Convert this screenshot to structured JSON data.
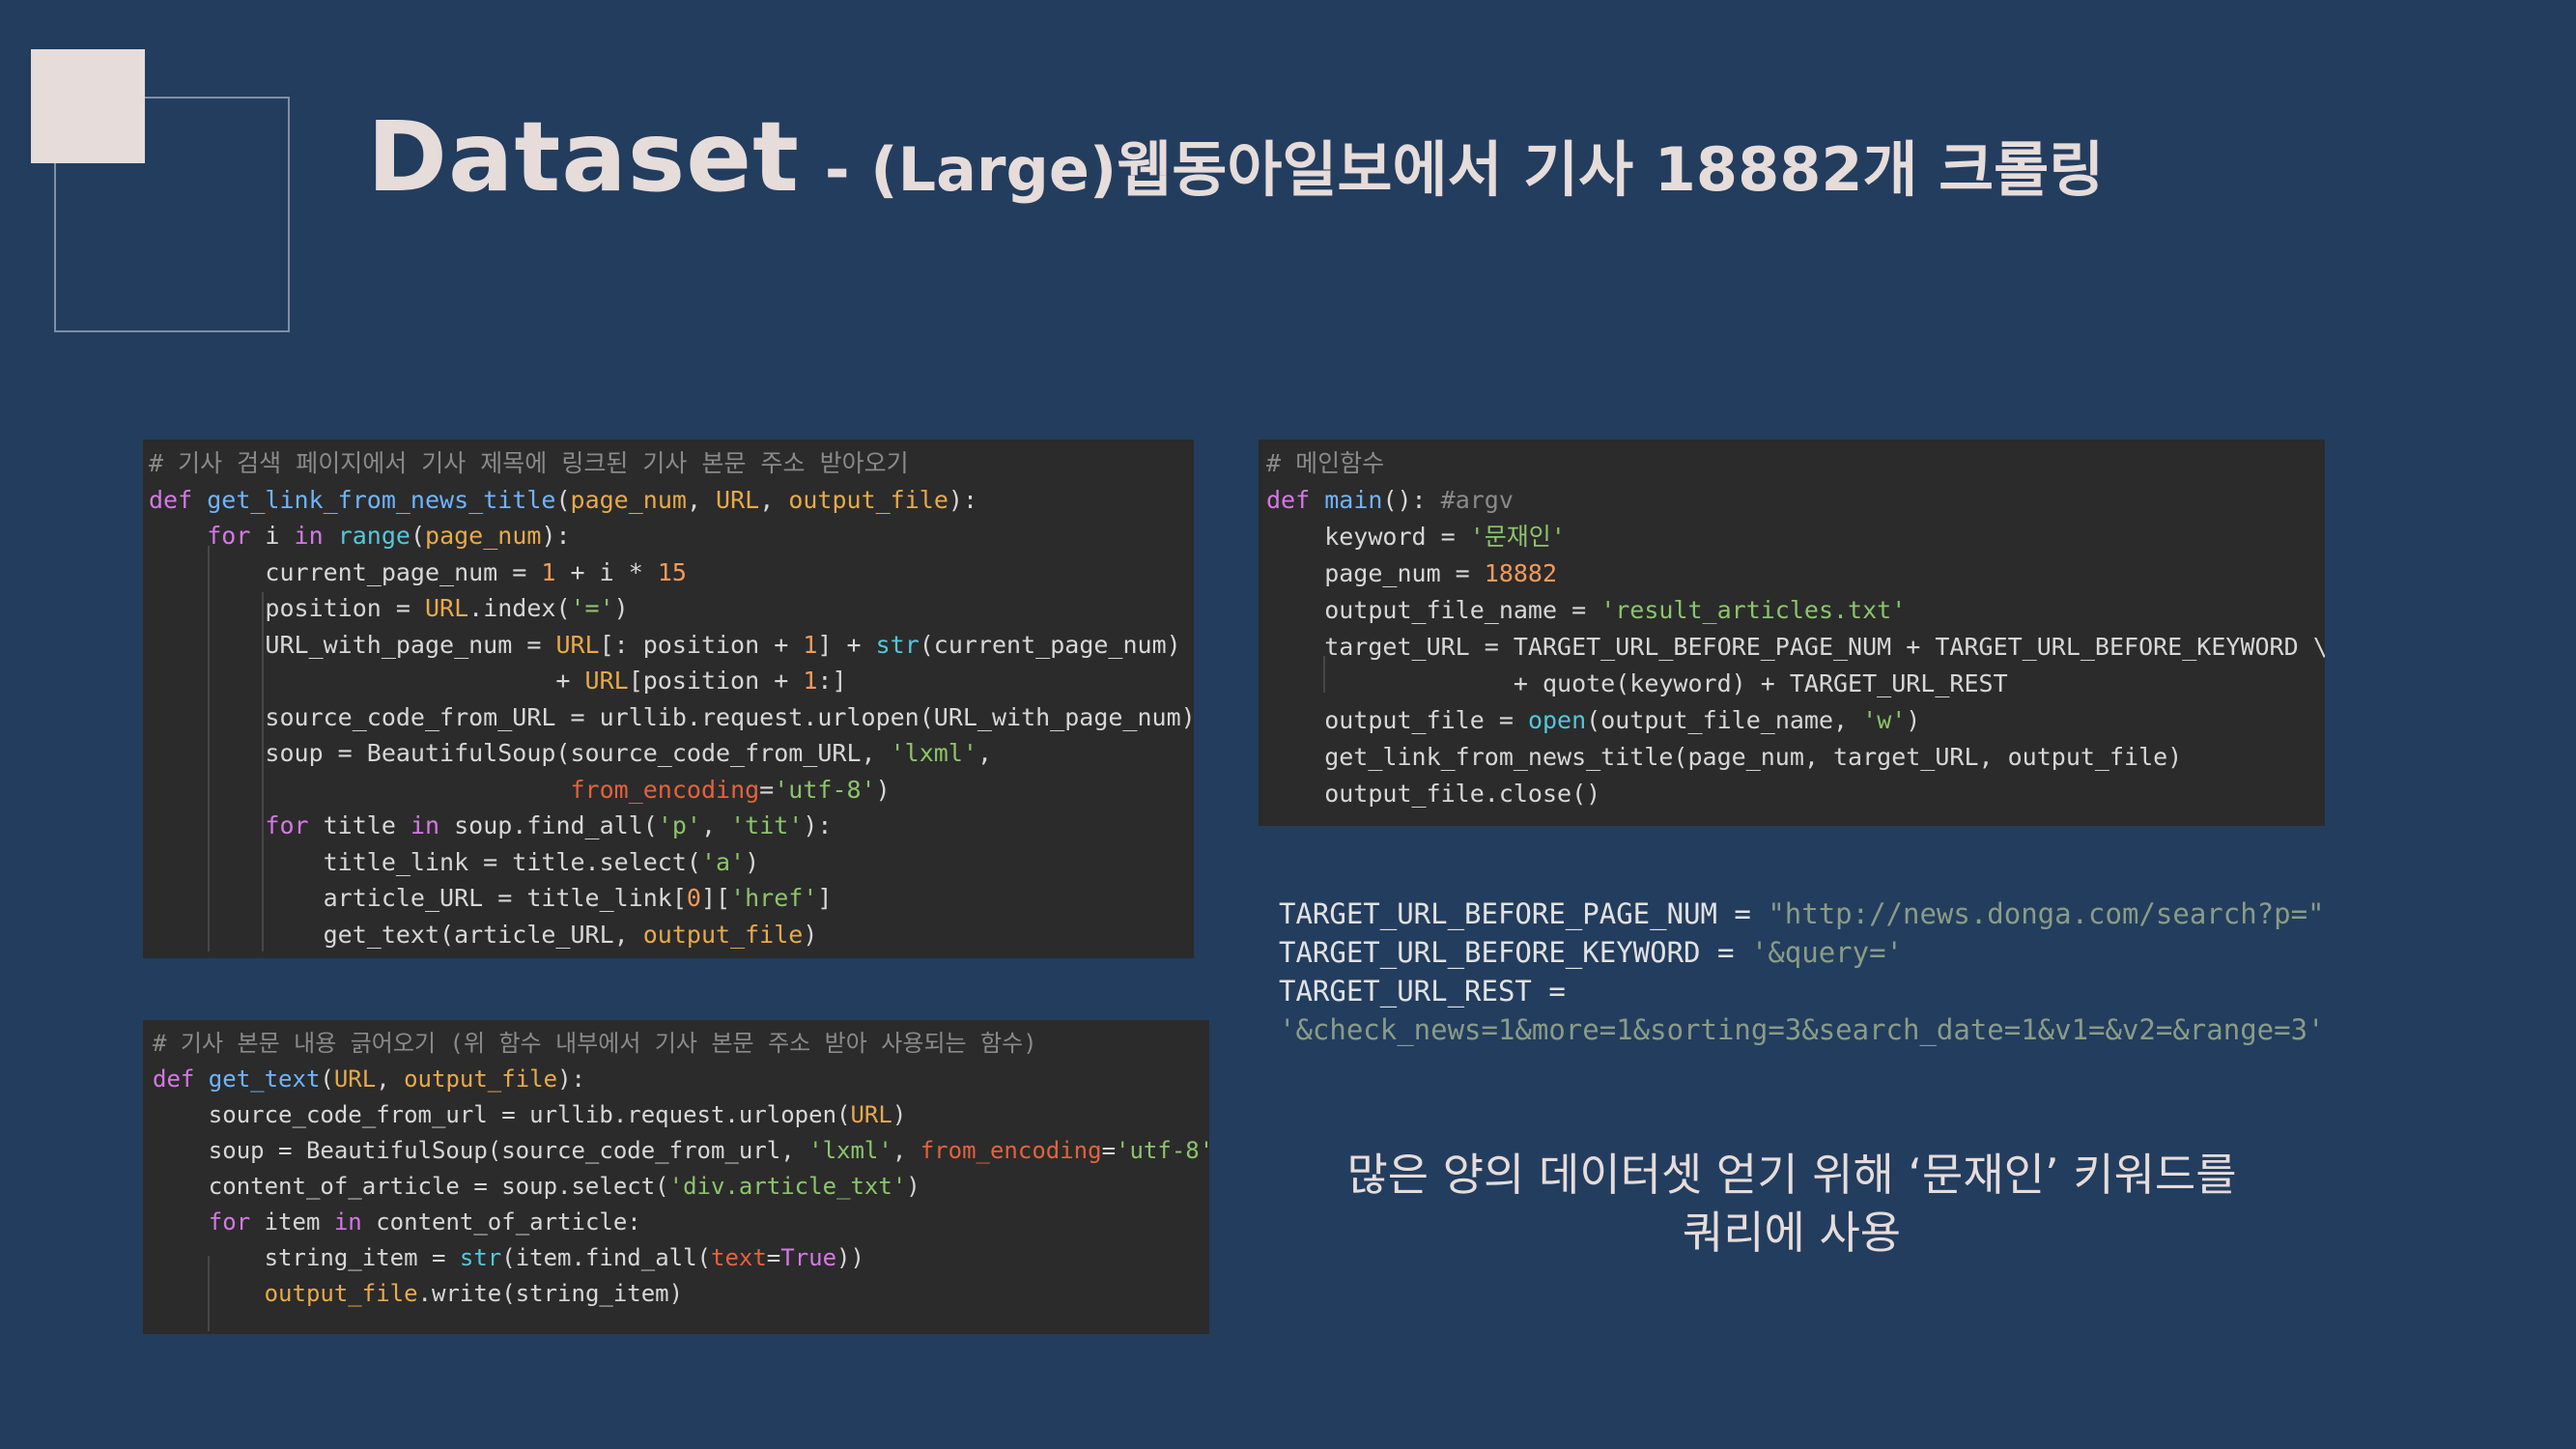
{
  "slide": {
    "title": "Dataset",
    "subtitle": "- (Large)웹동아일보에서 기사 18882개 크롤링",
    "caption_line1": "많은 양의 데이터셋 얻기 위해 ‘문재인’ 키워드를",
    "caption_line2": "쿼리에 사용"
  },
  "colors": {
    "background": "#233d5e",
    "title_text": "#e6dcda",
    "code_background": "#2b2b2b",
    "keyword": "#d677e6",
    "function": "#6eb4ff",
    "parameter": "#e8a94a",
    "string": "#8bc56b",
    "number": "#f29b5c",
    "comment": "#8a8a8a"
  },
  "code_top_left": [
    [
      [
        "com",
        "# 기사 검색 페이지에서 기사 제목에 링크된 기사 본문 주소 받아오기"
      ]
    ],
    [
      [
        "kw",
        "def "
      ],
      [
        "fn",
        "get_link_from_news_title"
      ],
      [
        "",
        "("
      ],
      [
        "par",
        "page_num"
      ],
      [
        "",
        ", "
      ],
      [
        "par",
        "URL"
      ],
      [
        "",
        ", "
      ],
      [
        "par",
        "output_file"
      ],
      [
        "",
        "):"
      ]
    ],
    [
      [
        "",
        "    "
      ],
      [
        "kw",
        "for"
      ],
      [
        "",
        " i "
      ],
      [
        "kw",
        "in"
      ],
      [
        "",
        " "
      ],
      [
        "bi",
        "range"
      ],
      [
        "",
        "("
      ],
      [
        "par",
        "page_num"
      ],
      [
        "",
        "):"
      ]
    ],
    [
      [
        "",
        "        current_page_num = "
      ],
      [
        "num",
        "1"
      ],
      [
        "",
        " + i * "
      ],
      [
        "num",
        "15"
      ]
    ],
    [
      [
        "",
        "        position = "
      ],
      [
        "par",
        "URL"
      ],
      [
        "",
        ".index("
      ],
      [
        "str",
        "'='"
      ],
      [
        "",
        ")"
      ]
    ],
    [
      [
        "",
        "        URL_with_page_num = "
      ],
      [
        "par",
        "URL"
      ],
      [
        "",
        "[: position + "
      ],
      [
        "num",
        "1"
      ],
      [
        "",
        "] + "
      ],
      [
        "bi",
        "str"
      ],
      [
        "",
        "(current_page_num) \\"
      ]
    ],
    [
      [
        "",
        "                            + "
      ],
      [
        "par",
        "URL"
      ],
      [
        "",
        "[position + "
      ],
      [
        "num",
        "1"
      ],
      [
        "",
        ":]"
      ]
    ],
    [
      [
        "",
        "        source_code_from_URL = urllib.request.urlopen(URL_with_page_num)"
      ]
    ],
    [
      [
        "",
        "        soup = BeautifulSoup(source_code_from_URL, "
      ],
      [
        "str",
        "'lxml'"
      ],
      [
        "",
        ","
      ]
    ],
    [
      [
        "",
        "                             "
      ],
      [
        "kwarg",
        "from_encoding"
      ],
      [
        "",
        "="
      ],
      [
        "str",
        "'utf-8'"
      ],
      [
        "",
        ")"
      ]
    ],
    [
      [
        "",
        "        "
      ],
      [
        "kw",
        "for"
      ],
      [
        "",
        " title "
      ],
      [
        "kw",
        "in"
      ],
      [
        "",
        " soup.find_all("
      ],
      [
        "str",
        "'p'"
      ],
      [
        "",
        ", "
      ],
      [
        "str",
        "'tit'"
      ],
      [
        "",
        "):"
      ]
    ],
    [
      [
        "",
        "            title_link = title.select("
      ],
      [
        "str",
        "'a'"
      ],
      [
        "",
        ")"
      ]
    ],
    [
      [
        "",
        "            article_URL = title_link["
      ],
      [
        "num",
        "0"
      ],
      [
        "",
        "]["
      ],
      [
        "str",
        "'href'"
      ],
      [
        "",
        "]"
      ]
    ],
    [
      [
        "",
        "            get_text(article_URL, "
      ],
      [
        "par",
        "output_file"
      ],
      [
        "",
        ")"
      ]
    ]
  ],
  "code_bottom_left": [
    [
      [
        "com",
        "# 기사 본문 내용 긁어오기 (위 함수 내부에서 기사 본문 주소 받아 사용되는 함수)"
      ]
    ],
    [
      [
        "kw",
        "def "
      ],
      [
        "fn",
        "get_text"
      ],
      [
        "",
        "("
      ],
      [
        "par",
        "URL"
      ],
      [
        "",
        ", "
      ],
      [
        "par",
        "output_file"
      ],
      [
        "",
        "):"
      ]
    ],
    [
      [
        "",
        "    source_code_from_url = urllib.request.urlopen("
      ],
      [
        "par",
        "URL"
      ],
      [
        "",
        ")"
      ]
    ],
    [
      [
        "",
        "    soup = BeautifulSoup(source_code_from_url, "
      ],
      [
        "str",
        "'lxml'"
      ],
      [
        "",
        ", "
      ],
      [
        "kwarg",
        "from_encoding"
      ],
      [
        "",
        "="
      ],
      [
        "str",
        "'utf-8'"
      ],
      [
        "",
        ")"
      ]
    ],
    [
      [
        "",
        "    content_of_article = soup.select("
      ],
      [
        "str",
        "'div.article_txt'"
      ],
      [
        "",
        ")"
      ]
    ],
    [
      [
        "",
        "    "
      ],
      [
        "kw",
        "for"
      ],
      [
        "",
        " item "
      ],
      [
        "kw",
        "in"
      ],
      [
        "",
        " content_of_article:"
      ]
    ],
    [
      [
        "",
        "        string_item = "
      ],
      [
        "bi",
        "str"
      ],
      [
        "",
        "(item.find_all("
      ],
      [
        "kwarg",
        "text"
      ],
      [
        "",
        "="
      ],
      [
        "kw",
        "True"
      ],
      [
        "",
        "))"
      ]
    ],
    [
      [
        "",
        "        "
      ],
      [
        "par",
        "output_file"
      ],
      [
        "",
        ".write(string_item)"
      ]
    ]
  ],
  "code_top_right": [
    [
      [
        "com",
        "# 메인함수"
      ]
    ],
    [
      [
        "kw",
        "def "
      ],
      [
        "fn",
        "main"
      ],
      [
        "",
        "(): "
      ],
      [
        "com",
        "#argv"
      ]
    ],
    [
      [
        "",
        "    keyword = "
      ],
      [
        "str",
        "'문재인'"
      ]
    ],
    [
      [
        "",
        "    page_num = "
      ],
      [
        "num",
        "18882"
      ]
    ],
    [
      [
        "",
        "    output_file_name = "
      ],
      [
        "str",
        "'result_articles.txt'"
      ]
    ],
    [
      [
        "",
        "    target_URL = TARGET_URL_BEFORE_PAGE_NUM + TARGET_URL_BEFORE_KEYWORD \\"
      ]
    ],
    [
      [
        "",
        "                 + quote(keyword) + TARGET_URL_REST"
      ]
    ],
    [
      [
        "",
        "    output_file = "
      ],
      [
        "bi",
        "open"
      ],
      [
        "",
        "(output_file_name, "
      ],
      [
        "str",
        "'w'"
      ],
      [
        "",
        ")"
      ]
    ],
    [
      [
        "",
        "    get_link_from_news_title(page_num, target_URL, output_file)"
      ]
    ],
    [
      [
        "",
        "    output_file.close()"
      ]
    ]
  ],
  "constants": [
    {
      "name": "TARGET_URL_BEFORE_PAGE_NUM = ",
      "value": "\"http://news.donga.com/search?p=\""
    },
    {
      "name": "TARGET_URL_BEFORE_KEYWORD = ",
      "value": "'&query='"
    },
    {
      "name": "TARGET_URL_REST = ",
      "value": ""
    },
    {
      "name": "",
      "value": "'&check_news=1&more=1&sorting=3&search_date=1&v1=&v2=&range=3'"
    }
  ]
}
